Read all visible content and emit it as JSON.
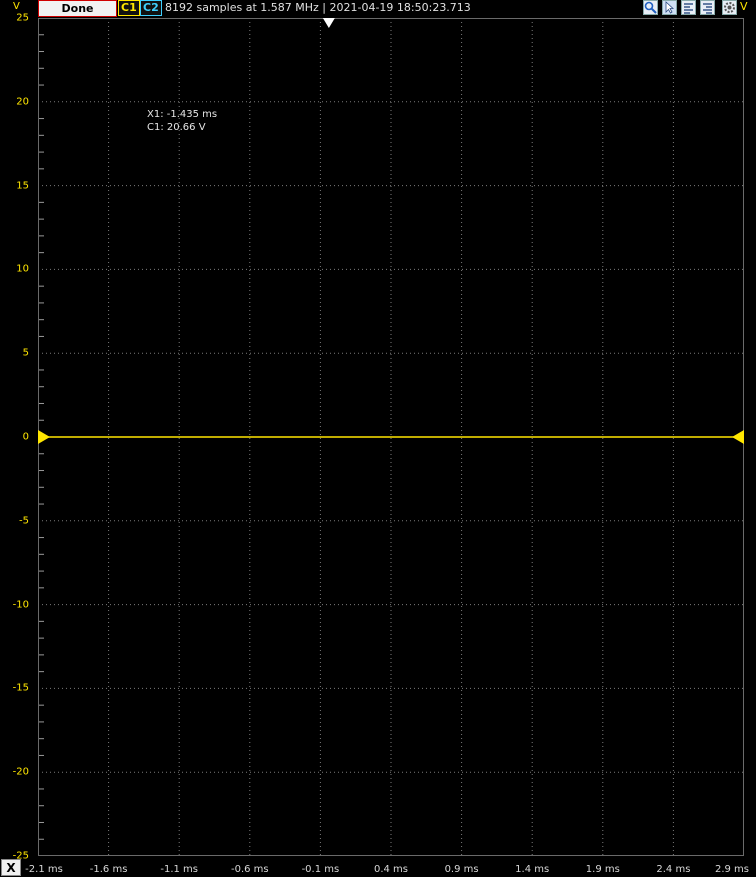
{
  "toolbar": {
    "done_label": "Done",
    "channel1_label": "C1",
    "channel2_label": "C2",
    "status": "8192 samples at 1.587 MHz | 2021-04-19 18:50:23.713",
    "icons": [
      "zoom-icon",
      "pointer-icon",
      "align-left-icon",
      "align-right-icon",
      "settings-icon"
    ]
  },
  "colors": {
    "background": "#000000",
    "grid": "#9a9a9a",
    "channel1": "#ffe600",
    "channel2": "#3fd0ff",
    "done_border": "#d00000"
  },
  "y_axis": {
    "unit": "V",
    "ticks": [
      "25",
      "20",
      "15",
      "10",
      "5",
      "0",
      "-5",
      "-10",
      "-15",
      "-20",
      "-25"
    ]
  },
  "x_axis": {
    "button_label": "X",
    "ticks": [
      "-2.1 ms",
      "-1.6 ms",
      "-1.1 ms",
      "-0.6 ms",
      "-0.1 ms",
      "0.4 ms",
      "0.9 ms",
      "1.4 ms",
      "1.9 ms",
      "2.4 ms",
      "2.9 ms"
    ]
  },
  "cursor_readout": {
    "x1": "X1: -1.435 ms",
    "c1": "C1: 20.66 V"
  },
  "chart_data": {
    "type": "line",
    "x_range_ms": [
      -2.1,
      2.9
    ],
    "y_range_v": [
      -25,
      25
    ],
    "grid": true,
    "series": [
      {
        "name": "C1",
        "x": [
          -2.1,
          2.9
        ],
        "values": [
          0,
          0
        ]
      }
    ],
    "trigger_x_ms": -0.04,
    "c1_offset_v": 0
  }
}
